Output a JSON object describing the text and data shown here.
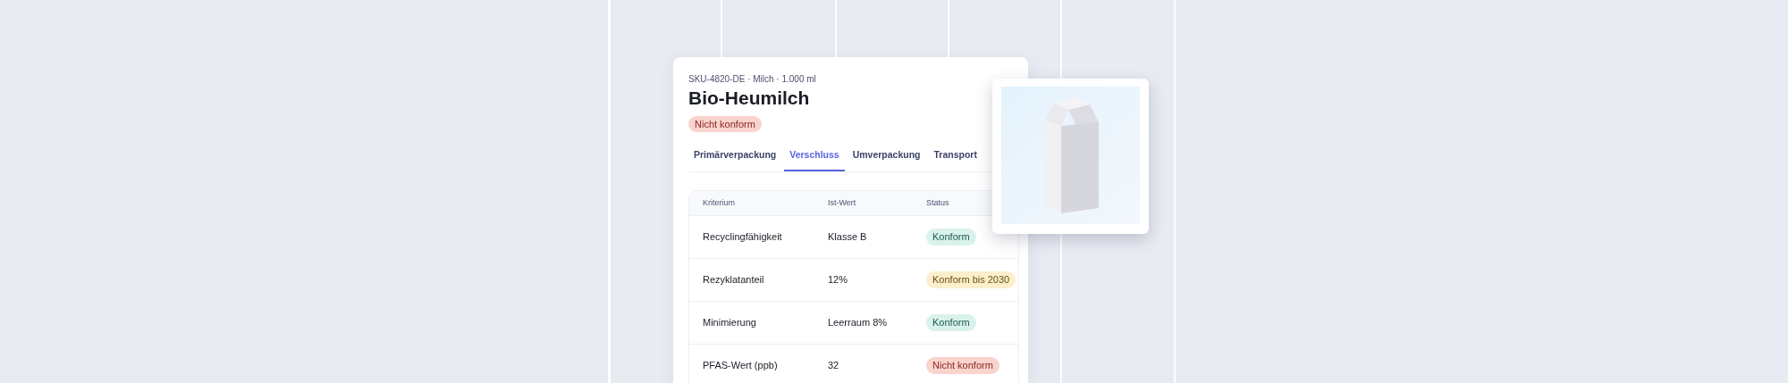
{
  "product": {
    "meta": "SKU-4820-DE · Milch · 1.000 ml",
    "title": "Bio-Heumilch",
    "status": {
      "label": "Nicht konform",
      "kind": "fail"
    }
  },
  "tabs": [
    {
      "label": "Primärverpackung",
      "selected": false
    },
    {
      "label": "Verschluss",
      "selected": true
    },
    {
      "label": "Umverpackung",
      "selected": false
    },
    {
      "label": "Transport",
      "selected": false
    }
  ],
  "table": {
    "columns": [
      "Kriterium",
      "Ist-Wert",
      "Status"
    ],
    "rows": [
      {
        "criterion": "Recyclingfähigkeit",
        "value": "Klasse B",
        "status": {
          "label": "Konform",
          "kind": "ok"
        }
      },
      {
        "criterion": "Rezyklatanteil",
        "value": "12%",
        "status": {
          "label": "Konform bis 2030",
          "kind": "warn"
        }
      },
      {
        "criterion": "Minimierung",
        "value": "Leerraum 8%",
        "status": {
          "label": "Konform",
          "kind": "ok"
        }
      },
      {
        "criterion": "PFAS-Wert (ppb)",
        "value": "32",
        "status": {
          "label": "Nicht konform",
          "kind": "fail"
        }
      }
    ]
  }
}
